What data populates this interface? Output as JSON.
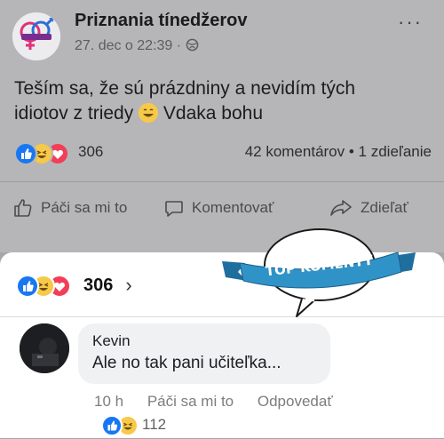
{
  "post": {
    "page_name": "Priznania tínedžerov",
    "meta": "27. dec o 22:39 · ",
    "text_before_emoji": "Teším sa, že sú prázdniny a nevidím tých idiotov z triedy ",
    "text_after_emoji": " Vdaka bohu",
    "reaction_count": "306",
    "comments_shares": "42 komentárov • 1 zdieľanie",
    "more_icon": "more-horizontal-icon"
  },
  "actions": {
    "like": "Páči sa mi to",
    "comment": "Komentovať",
    "share": "Zdieľať"
  },
  "panel": {
    "reaction_count": "306",
    "chevron": "›"
  },
  "stamp": {
    "label": "TOP KOMENTY"
  },
  "comment": {
    "author": "Kevin",
    "text": "Ale no tak pani učiteľka...",
    "time": "10 h",
    "like": "Páči sa mi to",
    "reply": "Odpovedať",
    "reaction_count": "112"
  },
  "colors": {
    "like_blue": "#1877f2",
    "love_red": "#f33e58",
    "haha_yellow": "#f7c948",
    "banner_blue": "#2f93c8"
  }
}
